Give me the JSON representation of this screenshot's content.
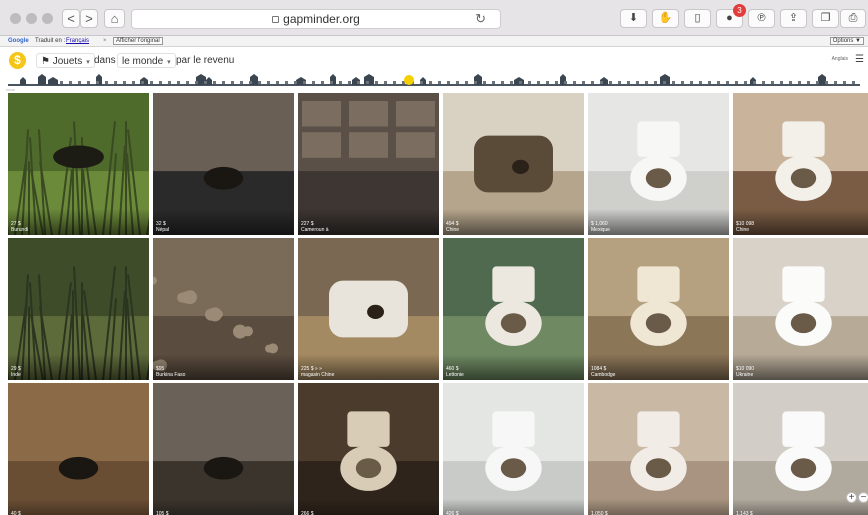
{
  "browser": {
    "url": "gapminder.org",
    "back_label": "<",
    "forward_label": ">",
    "home_glyph": "⌂",
    "reload_glyph": "↻",
    "toolbar_icons": [
      "download-icon",
      "hand-icon",
      "sidebar-icon",
      "extension-icon",
      "pinterest-icon",
      "share-icon",
      "tabs-icon",
      "print-icon"
    ],
    "extension_badge": "3"
  },
  "translate_bar": {
    "google": "Google",
    "label": "Traduit en :",
    "language": "Français",
    "close": "×",
    "show_original": "Afficher l'original",
    "options": "Options ▼"
  },
  "app": {
    "logo_letter": "$",
    "topic": "Jouets",
    "in_word": "dans",
    "region": "le monde",
    "sort": "par le revenu",
    "language_link": "Anglais",
    "menu_glyph": "☰"
  },
  "income_strip": {
    "label": "POOR",
    "highlight_color": "#f5d000"
  },
  "tiles": [
    {
      "price": "27 $",
      "country": "Burundi",
      "theme": "grass"
    },
    {
      "price": "32 $",
      "country": "Népal",
      "theme": "dirt-tarp"
    },
    {
      "price": "227 $",
      "country": "Cameroun à",
      "theme": "stone"
    },
    {
      "price": "494 $",
      "country": "Chine",
      "theme": "squat"
    },
    {
      "price": "$ 1,060",
      "country": "Mexique",
      "theme": "white-bath"
    },
    {
      "price": "$10 098",
      "country": "Chine",
      "theme": "modern-bath"
    },
    {
      "price": "29 $",
      "country": "Inde",
      "theme": "grass-dark"
    },
    {
      "price": "$95",
      "country": "Burkina Faso",
      "theme": "rubble"
    },
    {
      "price": "225 $ » »",
      "country": "magasin Chine",
      "theme": "squat-rust"
    },
    {
      "price": "460 $",
      "country": "Lettonie",
      "theme": "toilet-green"
    },
    {
      "price": "1084 $",
      "country": "Cambodge",
      "theme": "toilet-beige"
    },
    {
      "price": "$10 090",
      "country": "Ukraine",
      "theme": "toilet-white"
    },
    {
      "price": "40 $",
      "country": "",
      "theme": "pit-stone"
    },
    {
      "price": "105 $",
      "country": "",
      "theme": "wood-floor"
    },
    {
      "price": "266 $",
      "country": "",
      "theme": "toilet-dirty"
    },
    {
      "price": "426 $",
      "country": "",
      "theme": "tile-toilet"
    },
    {
      "price": "1,050 $",
      "country": "",
      "theme": "pink-bath"
    },
    {
      "price": "1,143 $",
      "country": "",
      "theme": "white-toilet-room"
    }
  ],
  "zoom": {
    "plus": "+",
    "minus": "−"
  }
}
